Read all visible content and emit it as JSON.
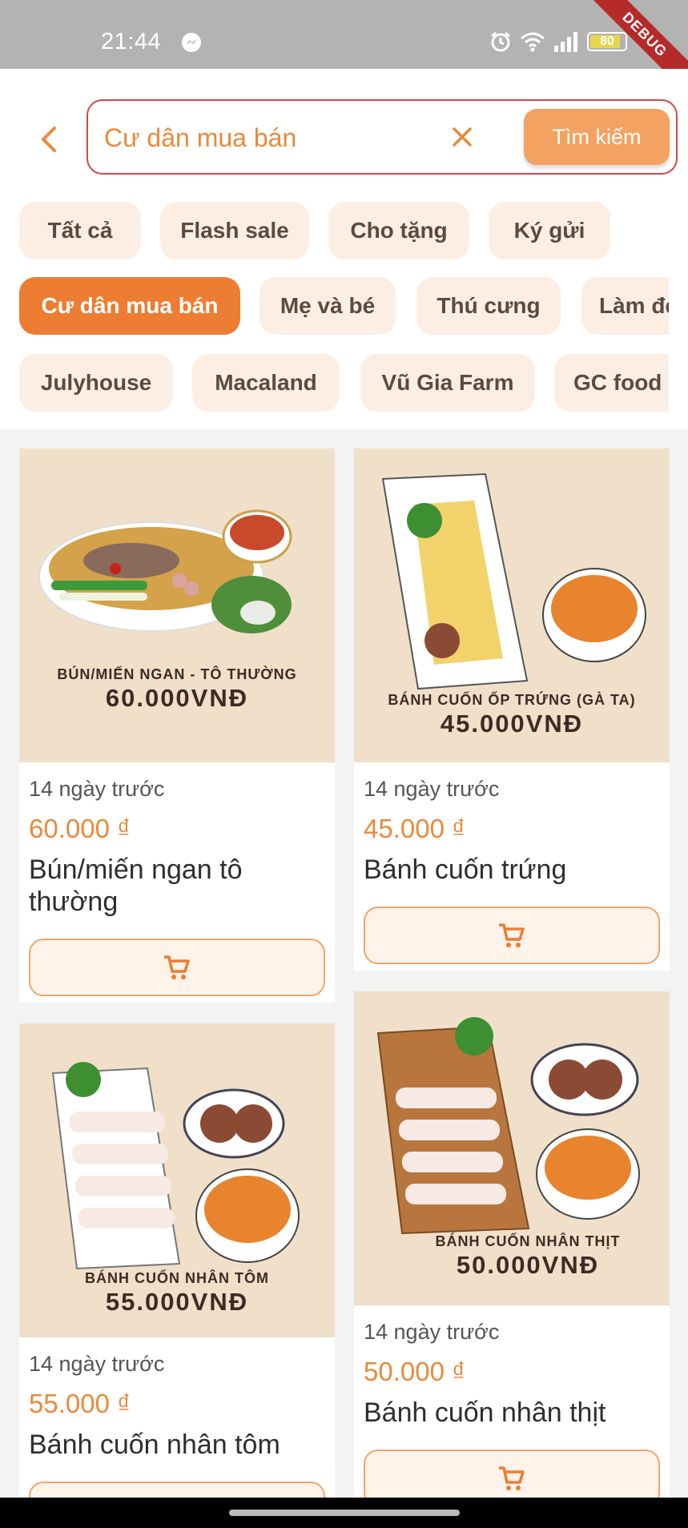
{
  "status_bar": {
    "time": "21:44",
    "battery": "80",
    "debug_label": "DEBUG"
  },
  "search": {
    "value": "Cư dân mua bán",
    "button_label": "Tìm kiếm"
  },
  "chips": {
    "row1": [
      "Tất cả",
      "Flash sale",
      "Cho tặng",
      "Ký gửi"
    ],
    "row2": [
      "Cư dân mua bán",
      "Mẹ và bé",
      "Thú cưng",
      "Làm đẹp"
    ],
    "row3": [
      "Julyhouse",
      "Macaland",
      "Vũ Gia Farm",
      "GC food"
    ],
    "active": "Cư dân mua bán"
  },
  "products": [
    {
      "poster_name": "BÚN/MIẾN NGAN - TÔ THƯỜNG",
      "poster_price": "60.000VNĐ",
      "time": "14 ngày trước",
      "price": "60.000 ₫",
      "name": "Bún/miến ngan tô thường"
    },
    {
      "poster_name": "BÁNH CUỐN ỐP TRỨNG (GÀ TA)",
      "poster_price": "45.000VNĐ",
      "time": "14 ngày trước",
      "price": "45.000 ₫",
      "name": "Bánh cuốn trứng"
    },
    {
      "poster_name": "BÁNH CUỐN NHÂN TÔM",
      "poster_price": "55.000VNĐ",
      "time": "14 ngày trước",
      "price": "55.000 ₫",
      "name": "Bánh cuốn nhân tôm"
    },
    {
      "poster_name": "BÁNH CUỐN NHÂN THỊT",
      "poster_price": "50.000VNĐ",
      "time": "14 ngày trước",
      "price": "50.000 ₫",
      "name": "Bánh cuốn nhân thịt"
    }
  ],
  "colors": {
    "accent": "#ec7d32",
    "price": "#e88a3a",
    "chip_bg": "#fdeee3",
    "poster_bg": "#f0e0ca",
    "search_border": "#d24747"
  },
  "icons": [
    "messenger-icon",
    "alarm-icon",
    "wifi-icon",
    "signal-icon",
    "battery-icon",
    "back-chevron-icon",
    "clear-icon",
    "cart-icon"
  ]
}
